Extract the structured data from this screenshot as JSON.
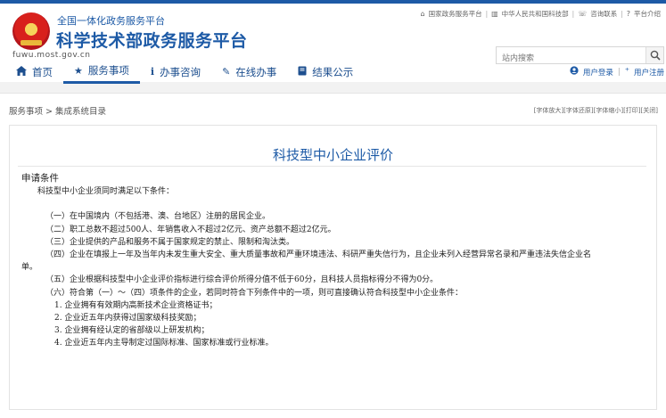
{
  "top_links": {
    "portal": "国家政务服务平台",
    "gov": "中华人民共和国科技部",
    "consult": "咨询联系",
    "help": "平台介绍"
  },
  "brand": {
    "subtitle": "全国一体化政务服务平台",
    "title": "科学技术部政务服务平台",
    "domain": "fuwu.most.gov.cn"
  },
  "search": {
    "placeholder": "站内搜索"
  },
  "nav": [
    {
      "label": "首页",
      "icon": "home-icon"
    },
    {
      "label": "服务事项",
      "icon": "star-icon",
      "active": true
    },
    {
      "label": "办事咨询",
      "icon": "info-icon"
    },
    {
      "label": "在线办事",
      "icon": "pencil-icon"
    },
    {
      "label": "结果公示",
      "icon": "book-icon"
    }
  ],
  "user": {
    "login": "用户登录",
    "register": "用户注册"
  },
  "breadcrumb": "服务事项 > 集成系统目录",
  "tools": "[字体放大][字体还原][字体缩小][打印][关闭]",
  "doc": {
    "title": "科技型中小企业评价",
    "section": "申请条件",
    "intro": "科技型中小企业须同时满足以下条件：",
    "conditions": [
      "（一）在中国境内（不包括港、澳、台地区）注册的居民企业。",
      "（二）职工总数不超过500人、年销售收入不超过2亿元、资产总额不超过2亿元。",
      "（三）企业提供的产品和服务不属于国家规定的禁止、限制和淘汰类。",
      "（四）企业在填报上一年及当年内未发生重大安全、重大质量事故和严重环境违法、科研严重失信行为，且企业未列入经营异常名录和严重违法失信企业名",
      "单。",
      "（五）企业根据科技型中小企业评价指标进行综合评价所得分值不低于60分，且科技人员指标得分不得为0分。",
      "（六）符合第（一）～（四）项条件的企业，若同时符合下列条件中的一项，则可直接确认符合科技型中小企业条件："
    ],
    "sub_items": [
      "1. 企业拥有有效期内高新技术企业资格证书；",
      "2. 企业近五年内获得过国家级科技奖励；",
      "3. 企业拥有经认定的省部级以上研发机构；",
      "4. 企业近五年内主导制定过国际标准、国家标准或行业标准。"
    ]
  },
  "colors": {
    "brand_blue": "#1d5aa6",
    "nav_text": "#1d4f8f",
    "page_bg": "#f2f2f2"
  }
}
